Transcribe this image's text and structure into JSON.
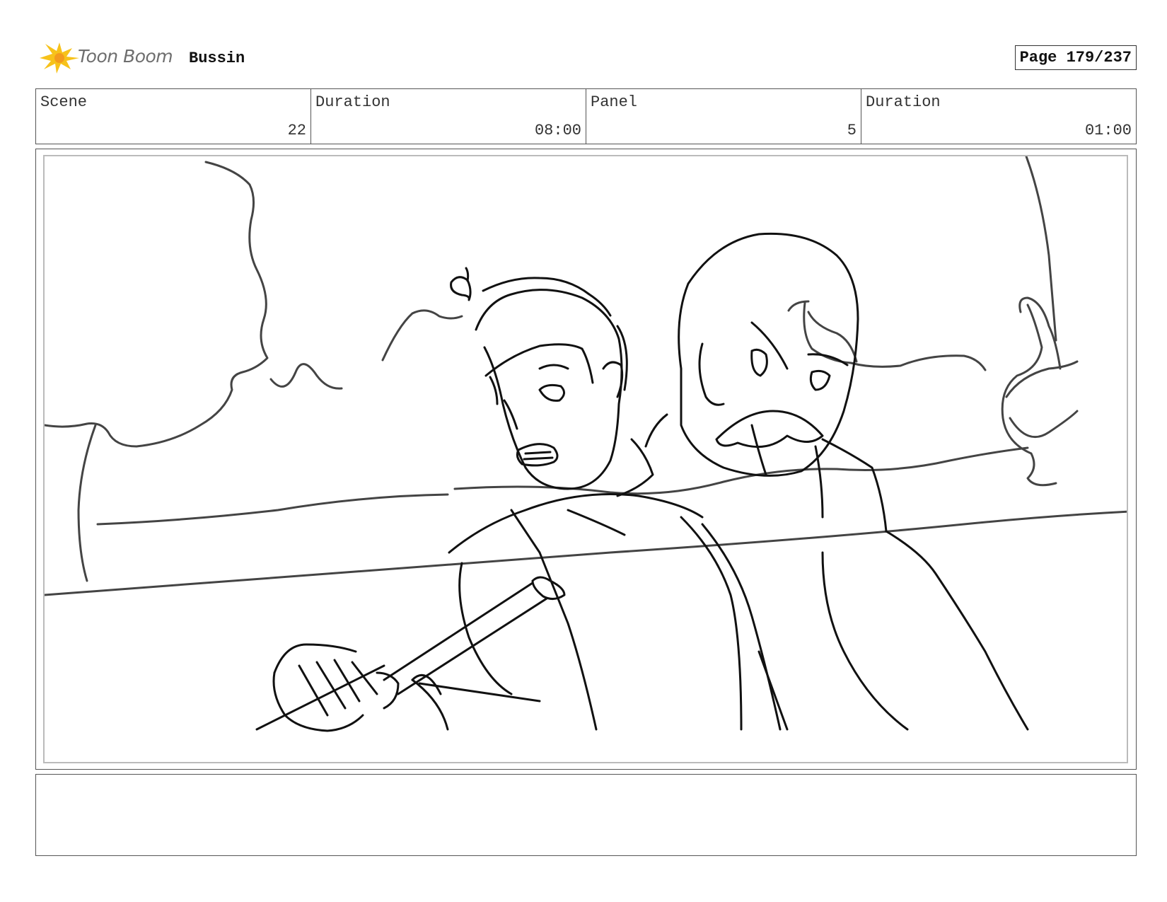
{
  "header": {
    "logo_text": "Toon Boom",
    "project_title": "Bussin",
    "page_label": "Page 179/237"
  },
  "info": {
    "scene_label": "Scene",
    "scene_value": "22",
    "scene_duration_label": "Duration",
    "scene_duration_value": "08:00",
    "panel_label": "Panel",
    "panel_value": "5",
    "panel_duration_label": "Duration",
    "panel_duration_value": "01:00"
  },
  "notes": {
    "text": ""
  },
  "colors": {
    "logo_yellow": "#f7c21a",
    "logo_orange": "#f39a1e",
    "border": "#555555",
    "sketch_line": "#111111",
    "sketch_gray": "#444444"
  }
}
